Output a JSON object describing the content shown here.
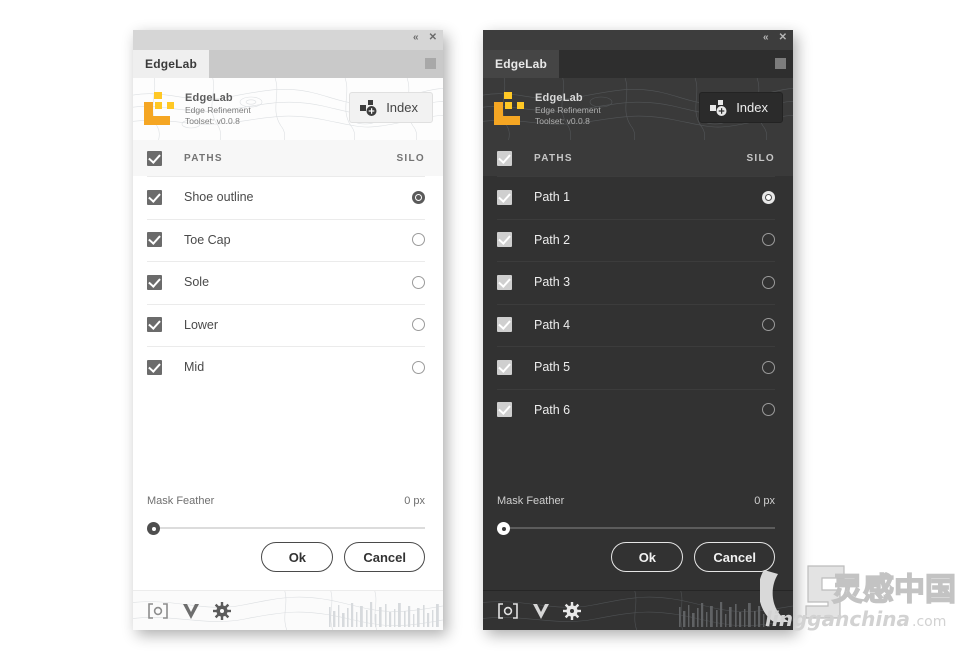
{
  "panels": [
    {
      "id": "light",
      "theme": "light",
      "titlebar": {
        "collapse_label": "«",
        "close_label": "✕",
        "collapse_icon": "double-chevron-left-icon",
        "close_icon": "close-icon"
      },
      "tab": {
        "label": "EdgeLab",
        "menu_icon": "panel-menu-icon"
      },
      "brand": {
        "logo_icon": "edgelab-logo-icon",
        "name": "EdgeLab",
        "subtitle_1": "Edge Refinement",
        "subtitle_2": "Toolset: v0.0.8",
        "index_button": {
          "label": "Index",
          "icon": "add-node-icon"
        }
      },
      "list": {
        "header": {
          "left": "PATHS",
          "right": "SILO",
          "checked": true
        },
        "rows": [
          {
            "label": "Shoe outline",
            "checked": true,
            "silo": true
          },
          {
            "label": "Toe Cap",
            "checked": true,
            "silo": false
          },
          {
            "label": "Sole",
            "checked": true,
            "silo": false
          },
          {
            "label": "Lower",
            "checked": true,
            "silo": false
          },
          {
            "label": "Mid",
            "checked": true,
            "silo": false
          }
        ]
      },
      "feather": {
        "label": "Mask Feather",
        "value": "0 px",
        "percent": 0
      },
      "buttons": {
        "ok": "Ok",
        "cancel": "Cancel"
      },
      "toolbar": {
        "icons": [
          {
            "name": "bracket-target-icon",
            "glyph": "[o]"
          },
          {
            "name": "v-logo-icon",
            "glyph": "V"
          },
          {
            "name": "gear-icon",
            "glyph": "⚙"
          }
        ]
      }
    },
    {
      "id": "dark",
      "theme": "dark",
      "titlebar": {
        "collapse_label": "«",
        "close_label": "✕",
        "collapse_icon": "double-chevron-left-icon",
        "close_icon": "close-icon"
      },
      "tab": {
        "label": "EdgeLab",
        "menu_icon": "panel-menu-icon"
      },
      "brand": {
        "logo_icon": "edgelab-logo-icon",
        "name": "EdgeLab",
        "subtitle_1": "Edge Refinement",
        "subtitle_2": "Toolset: v0.0.8",
        "index_button": {
          "label": "Index",
          "icon": "add-node-icon"
        }
      },
      "list": {
        "header": {
          "left": "PATHS",
          "right": "SILO",
          "checked": true
        },
        "rows": [
          {
            "label": "Path 1",
            "checked": true,
            "silo": true
          },
          {
            "label": "Path 2",
            "checked": true,
            "silo": false
          },
          {
            "label": "Path 3",
            "checked": true,
            "silo": false
          },
          {
            "label": "Path 4",
            "checked": true,
            "silo": false
          },
          {
            "label": "Path 5",
            "checked": true,
            "silo": false
          },
          {
            "label": "Path 6",
            "checked": true,
            "silo": false
          }
        ]
      },
      "feather": {
        "label": "Mask Feather",
        "value": "0 px",
        "percent": 0
      },
      "buttons": {
        "ok": "Ok",
        "cancel": "Cancel"
      },
      "toolbar": {
        "icons": [
          {
            "name": "bracket-target-icon",
            "glyph": "[o]"
          },
          {
            "name": "v-logo-icon",
            "glyph": "V"
          },
          {
            "name": "gear-icon",
            "glyph": "⚙"
          }
        ]
      }
    }
  ],
  "watermark": {
    "cjk_text": "灵感中国",
    "latin_text": "lingganchina",
    "tld_text": ".com"
  },
  "colors": {
    "brand_yellow": "#F5A623",
    "brand_yellow_light": "#FFC825",
    "light_panel_bg": "#FFFFFF",
    "dark_panel_bg": "#323232"
  }
}
